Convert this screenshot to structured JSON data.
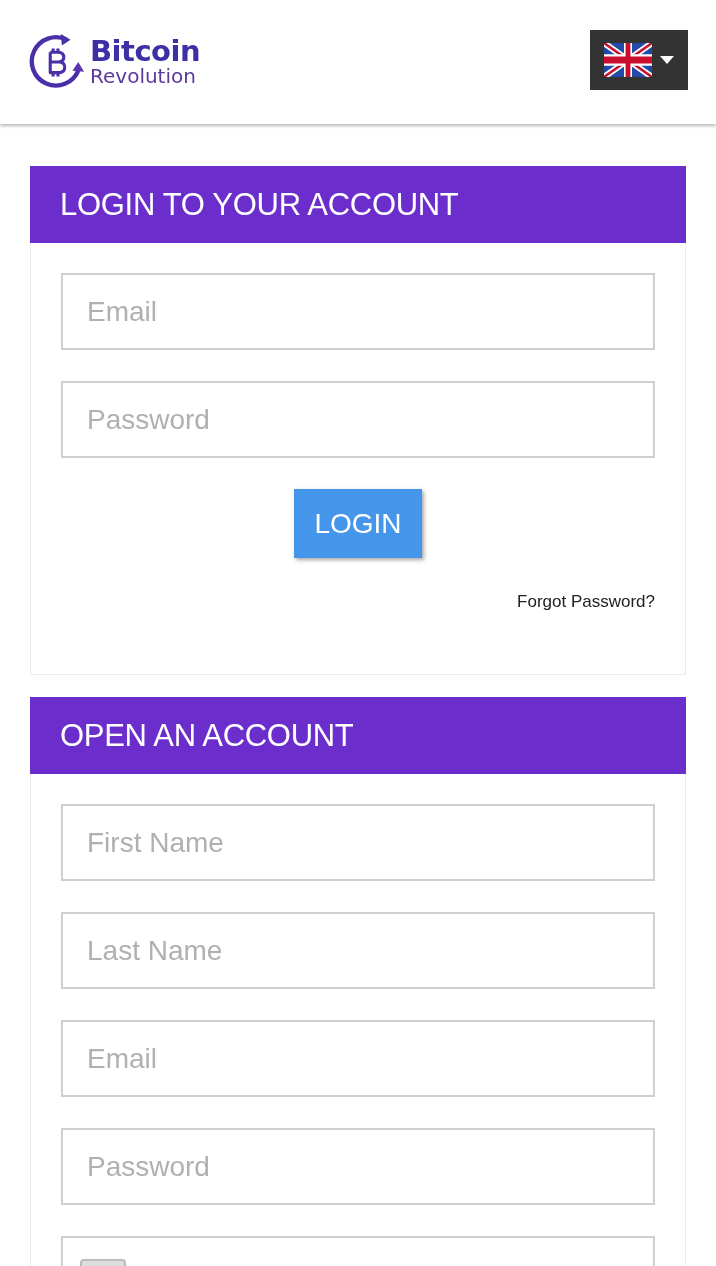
{
  "header": {
    "logo": {
      "title": "Bitcoin",
      "subtitle": "Revolution"
    }
  },
  "login": {
    "title": "LOGIN TO YOUR ACCOUNT",
    "fields": [
      {
        "kind": "text",
        "placeholder": "Email"
      },
      {
        "kind": "text",
        "placeholder": "Password"
      }
    ],
    "button": "LOGIN",
    "forgot_link": "Forgot Password?"
  },
  "register": {
    "title": "OPEN AN ACCOUNT",
    "fields": [
      {
        "kind": "text",
        "placeholder": "First Name"
      },
      {
        "kind": "text",
        "placeholder": "Last Name"
      },
      {
        "kind": "text",
        "placeholder": "Email"
      },
      {
        "kind": "text",
        "placeholder": "Password"
      },
      {
        "kind": "phone"
      }
    ]
  }
}
